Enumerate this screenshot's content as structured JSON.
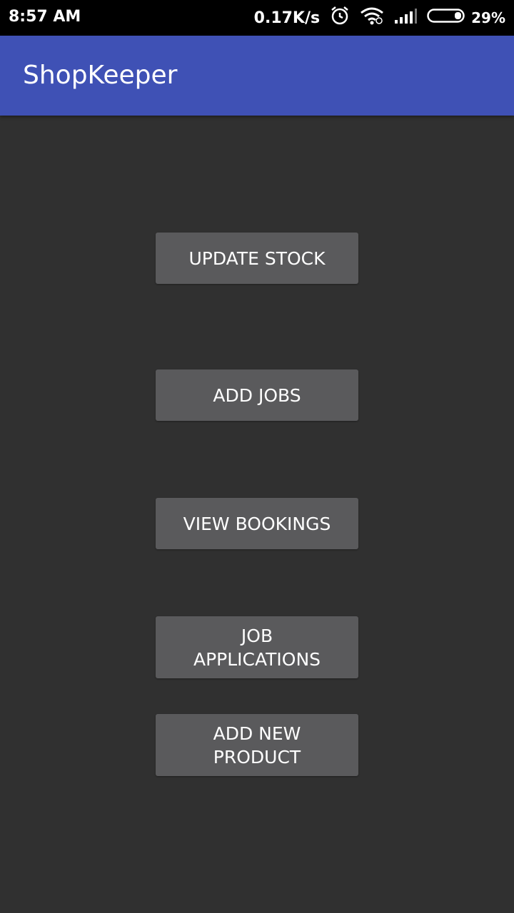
{
  "status_bar": {
    "time": "8:57 AM",
    "net_speed": "0.17K/s",
    "battery": "29%",
    "icons": [
      "alarm-icon",
      "wifi-icon",
      "signal-icon",
      "battery-icon"
    ]
  },
  "app_bar": {
    "title": "ShopKeeper",
    "color": "#3f51b5"
  },
  "main": {
    "buttons": [
      {
        "label": "UPDATE STOCK"
      },
      {
        "label": "ADD JOBS"
      },
      {
        "label": "VIEW BOOKINGS"
      },
      {
        "label": "JOB APPLICATIONS"
      },
      {
        "label": "ADD NEW PRODUCT"
      }
    ],
    "background": "#303030",
    "button_color": "#5a5a5c"
  }
}
